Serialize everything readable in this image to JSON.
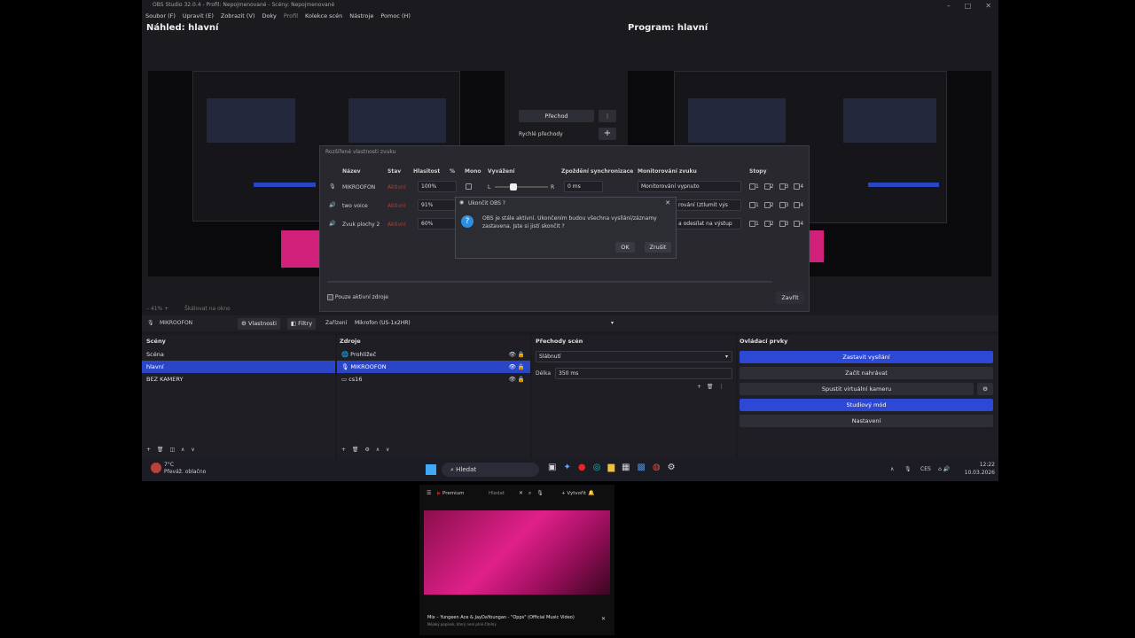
{
  "window": {
    "title": "OBS Studio 32.0.4 - Profil: Nepojmenované - Scény: Nepojmenované",
    "controls": [
      "–",
      "□",
      "✕"
    ]
  },
  "menu": [
    {
      "label": "Soubor (F)"
    },
    {
      "label": "Upravit (E)"
    },
    {
      "label": "Zobrazit (V)"
    },
    {
      "label": "Doky"
    },
    {
      "label": "Profil"
    },
    {
      "label": "Kolekce scén"
    },
    {
      "label": "Nástroje"
    },
    {
      "label": "Pomoc (H)"
    }
  ],
  "preview": {
    "title": "Náhled: hlavní"
  },
  "program": {
    "title": "Program: hlavní"
  },
  "transition_controls": {
    "button": "Přechod",
    "quick_label": "Rychlé přechody"
  },
  "audio_dialog": {
    "title": "Rozšířené vlastnosti zvuku",
    "columns": [
      "Název",
      "Stav",
      "Hlasitost",
      "%",
      "Mono",
      "Vyvážení",
      "Zpoždění synchronizace",
      "Monitorování zvuku",
      "Stopy"
    ],
    "rows": [
      {
        "name": "MIKROOFON",
        "state": "Aktivní",
        "volume": "100%",
        "sync": "0 ms",
        "monitor": "Monitorování vypnuto"
      },
      {
        "name": "two voice",
        "state": "Aktivní",
        "volume": "91%",
        "monitor": "rování (ztlumit výs"
      },
      {
        "name": "Zvuk plochy 2",
        "state": "Aktivní",
        "volume": "60%",
        "monitor": "a odesílat na výstup"
      }
    ],
    "balance_left": "L",
    "balance_right": "R",
    "tracks": [
      "1",
      "2",
      "3",
      "4"
    ],
    "active_only": "Pouze aktivní zdroje",
    "close_btn": "Zavřít"
  },
  "confirm_dialog": {
    "title": "Ukončit OBS ?",
    "message_line1": "OBS je stále aktivní. Ukončením budou všechna vysílání/záznamy",
    "message_line2": "zastavena. Jste si jistí skončit ?",
    "ok": "OK",
    "cancel": "Zrušit"
  },
  "preview_footer": {
    "zoom": "– 41%  +",
    "scale": "Škálovat na okno"
  },
  "source_toolbar": {
    "source": "MIKROOFON",
    "properties": "Vlastnosti",
    "filters": "Filtry",
    "device_label": "Zařízení",
    "device_value": "Mikrofon (US-1x2HR)"
  },
  "scenes": {
    "header": "Scény",
    "items": [
      "Scéna",
      "hlavní",
      "BEZ KAMERY"
    ],
    "selected": 1
  },
  "sources": {
    "header": "Zdroje",
    "items": [
      "Prohlížeč",
      "MIKROOFON",
      "cs16"
    ],
    "selected": 1
  },
  "transitions": {
    "header": "Přechody scén",
    "type": "Slábnutí",
    "duration_label": "Délka",
    "duration": "350 ms"
  },
  "controls": {
    "header": "Ovládací prvky",
    "buttons": [
      {
        "label": "Zastavit vysílání",
        "active": true
      },
      {
        "label": "Začít nahrávat",
        "active": false
      },
      {
        "label": "Spustit virtuální kameru",
        "active": false
      },
      {
        "label": "Studiový mód",
        "active": true
      },
      {
        "label": "Nastavení",
        "active": false
      }
    ]
  },
  "taskbar": {
    "weather_temp": "7°C",
    "weather_desc": "Převáž. oblačno",
    "search": "Hledat",
    "lang": "CES",
    "time": "12:22",
    "date": "10.03.2026"
  },
  "youtube": {
    "logo": "Premium",
    "search": "Hledat",
    "create": "Vytvořit",
    "video_title": "Mix – Yungeen Ace & JayDaYoungan - \"Opps\" (Official Music Video)",
    "video_sub": "Nějaký popisek, který není plně čitelný"
  },
  "colors": {
    "accent": "#2a46c7",
    "status_active": "#c0392b",
    "bg": "#1b1b1f"
  }
}
